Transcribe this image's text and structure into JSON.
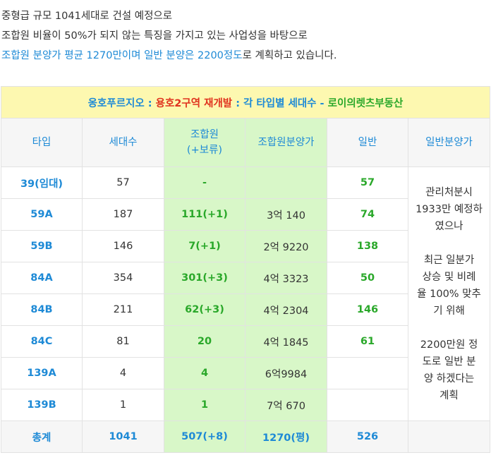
{
  "intro": {
    "line1": "중형급 규모 1041세대로 건설 예정으로",
    "line2": "조합원 비율이 50%가 되지 않는 특징을 가지고 있는 사업성을 바탕으로",
    "line3_highlight": "조합원 분양가 평균 1270만이며 일반 분양은 2200정도",
    "line3_rest": "로 계획하고 있습니다."
  },
  "table": {
    "caption": {
      "part1": "옹호푸르지오 : ",
      "part2": "용호2구역 재개발",
      "part3": " : 각 타입별 세대수 - ",
      "part4": "로이의렛츠부동산"
    },
    "headers": {
      "type": "타입",
      "households": "세대수",
      "members_line1": "조합원",
      "members_line2": "(+보류)",
      "member_price": "조합원분양가",
      "general": "일반",
      "general_price": "일반분양가"
    },
    "rows": [
      {
        "type": "39(임대)",
        "households": "57",
        "members": "-",
        "member_price": "",
        "general": "57"
      },
      {
        "type": "59A",
        "households": "187",
        "members": "111(+1)",
        "member_price": "3억 140",
        "general": "74"
      },
      {
        "type": "59B",
        "households": "146",
        "members": "7(+1)",
        "member_price": "2억 9220",
        "general": "138"
      },
      {
        "type": "84A",
        "households": "354",
        "members": "301(+3)",
        "member_price": "4억 3323",
        "general": "50"
      },
      {
        "type": "84B",
        "households": "211",
        "members": "62(+3)",
        "member_price": "4억 2304",
        "general": "146"
      },
      {
        "type": "84C",
        "households": "81",
        "members": "20",
        "member_price": "4억 1845",
        "general": "61"
      },
      {
        "type": "139A",
        "households": "4",
        "members": "4",
        "member_price": "6억9984",
        "general": ""
      },
      {
        "type": "139B",
        "households": "1",
        "members": "1",
        "member_price": "7억 670",
        "general": ""
      }
    ],
    "note": {
      "line1": "관리처분시",
      "line2": "1933만 예정하",
      "line3": "였으나",
      "line4": "최근 일분가",
      "line5": "상승 및 비례",
      "line6": "율 100% 맞추",
      "line7": "기 위해",
      "line8": "2200만원 정",
      "line9": "도로 일반 분",
      "line10": "양 하겠다는",
      "line11": "계획"
    },
    "total": {
      "label": "총계",
      "households": "1041",
      "members": "507(+8)",
      "member_price": "1270(평)",
      "general": "526",
      "general_price": ""
    }
  }
}
